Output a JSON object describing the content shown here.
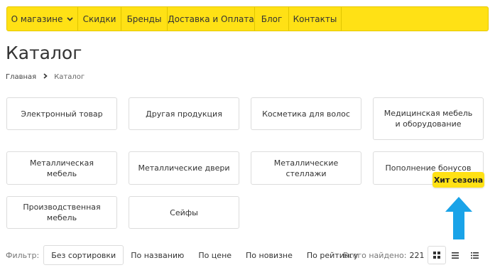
{
  "nav": {
    "items": [
      {
        "label": "О магазине"
      },
      {
        "label": "Скидки"
      },
      {
        "label": "Бренды"
      },
      {
        "label": "Доставка и Оплата"
      },
      {
        "label": "Блог"
      },
      {
        "label": "Контакты"
      }
    ]
  },
  "page": {
    "title": "Каталог"
  },
  "breadcrumb": {
    "home": "Главная",
    "current": "Каталог"
  },
  "categories": [
    {
      "label": "Электронный товар"
    },
    {
      "label": "Другая продукция"
    },
    {
      "label": "Косметика для волос"
    },
    {
      "label": "Медицинская мебель и оборудование"
    },
    {
      "label": "Металлическая мебель"
    },
    {
      "label": "Металлические двери"
    },
    {
      "label": "Металлические стеллажи"
    },
    {
      "label": "Пополнение бонусов"
    },
    {
      "label": "Производственная мебель"
    },
    {
      "label": "Сейфы"
    }
  ],
  "badge": {
    "label": "Хит сезона"
  },
  "filter": {
    "label": "Фильтр:",
    "options": [
      {
        "label": "Без сортировки"
      },
      {
        "label": "По названию"
      },
      {
        "label": "По цене"
      },
      {
        "label": "По новизне"
      },
      {
        "label": "По рейтингу"
      }
    ]
  },
  "results": {
    "label": "Всего найдено:",
    "count": "221"
  },
  "colors": {
    "accent": "#ffe115",
    "arrow": "#1aa3e8",
    "card_border": "#dcdcdc"
  },
  "icons": {
    "view_grid": "grid-icon",
    "view_list": "list-icon",
    "view_detailed": "detailed-list-icon",
    "dropdown": "chevron-down-icon"
  }
}
